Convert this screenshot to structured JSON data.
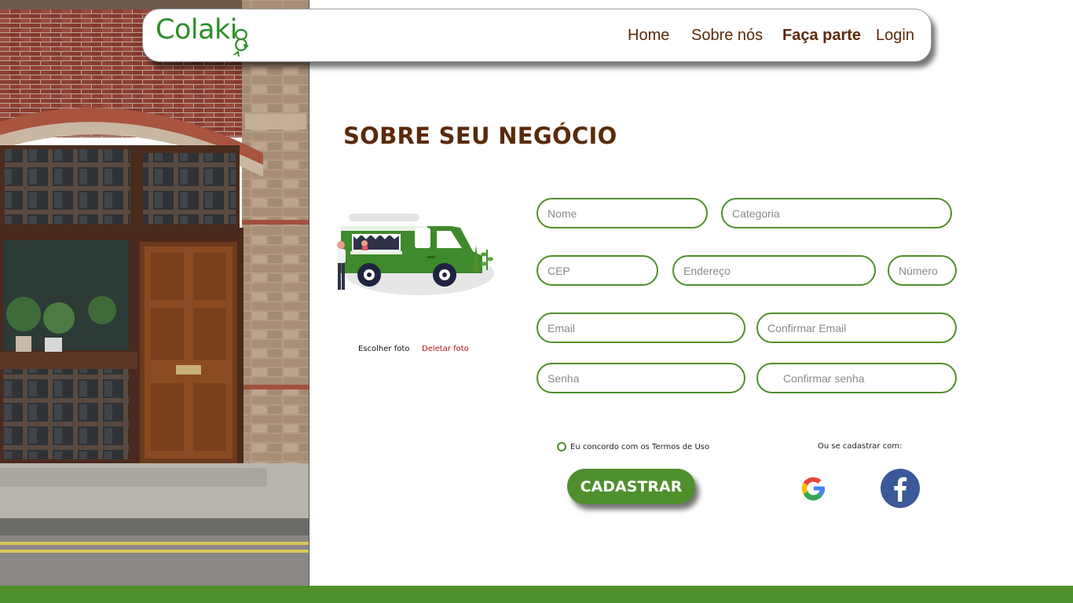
{
  "header": {
    "logo_text": "Colaki",
    "nav": [
      {
        "label": "Home"
      },
      {
        "label": "Sobre nós"
      },
      {
        "label": "Faça parte",
        "active": true
      },
      {
        "label": "Login"
      }
    ]
  },
  "main": {
    "title": "SOBRE SEU NEGÓCIO",
    "photo_actions": {
      "choose": "Escolher foto",
      "delete": "Deletar foto"
    },
    "fields": {
      "nome": "Nome",
      "categoria": "Categoria",
      "cep": "CEP",
      "endereco": "Endereço",
      "numero": "Número",
      "email": "Email",
      "confirmar_email": "Confirmar Email",
      "senha": "Senha",
      "confirmar_senha": "Confirmar senha"
    },
    "terms_label": "Eu concordo com os Termos de Uso",
    "submit_label": "CADASTRAR",
    "alt_signup_label": "Ou se cadastrar com:",
    "social": [
      "google",
      "facebook"
    ]
  },
  "colors": {
    "brand_green": "#4f8f2c",
    "logo_green": "#2d8f2a",
    "heading_brown": "#5b2a0a",
    "delete_red": "#b3121a"
  }
}
